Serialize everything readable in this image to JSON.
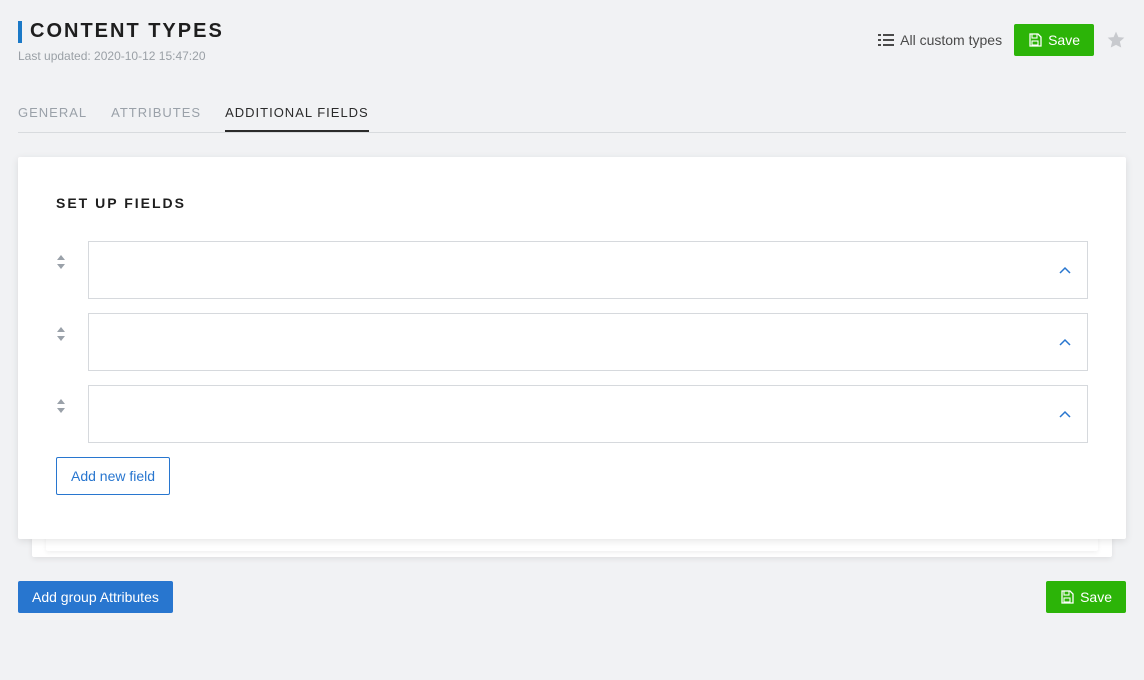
{
  "header": {
    "title": "Content types",
    "last_updated": "Last updated: 2020-10-12 15:47:20",
    "all_custom_types": "All custom types",
    "save": "Save"
  },
  "tabs": [
    {
      "label": "General",
      "active": false
    },
    {
      "label": "Attributes",
      "active": false
    },
    {
      "label": "Additional fields",
      "active": true
    }
  ],
  "panel": {
    "heading": "Set up fields",
    "add_new_field": "Add new field",
    "fields": [
      {},
      {},
      {}
    ]
  },
  "footer": {
    "add_group_attributes": "Add group Attributes",
    "save": "Save"
  }
}
